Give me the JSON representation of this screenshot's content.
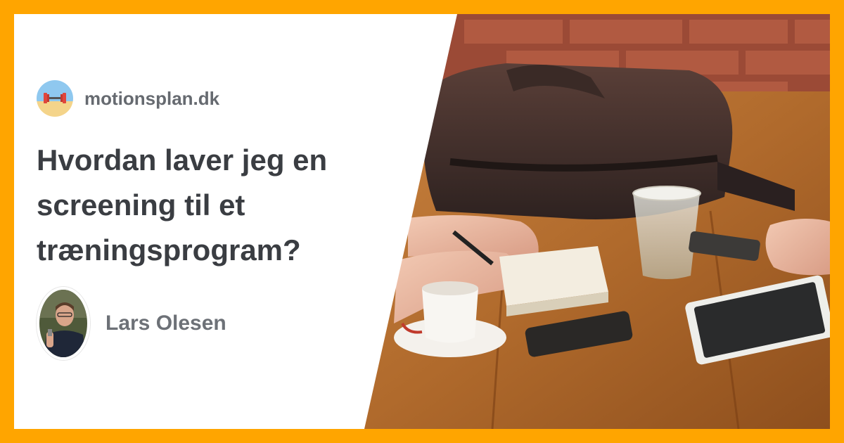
{
  "site": {
    "logo_icon": "dumbbell-beach-icon",
    "name": "motionsplan.dk"
  },
  "article": {
    "title": "Hvordan laver jeg en screening til et træningsprogram?"
  },
  "author": {
    "avatar_icon": "author-portrait-photo",
    "name": "Lars Olesen"
  },
  "photo": {
    "subject": "cafe-table-meeting-photo"
  },
  "colors": {
    "frame": "#FFA500",
    "panel": "#FFFFFF",
    "title": "#3A3D42",
    "meta": "#666A70"
  }
}
